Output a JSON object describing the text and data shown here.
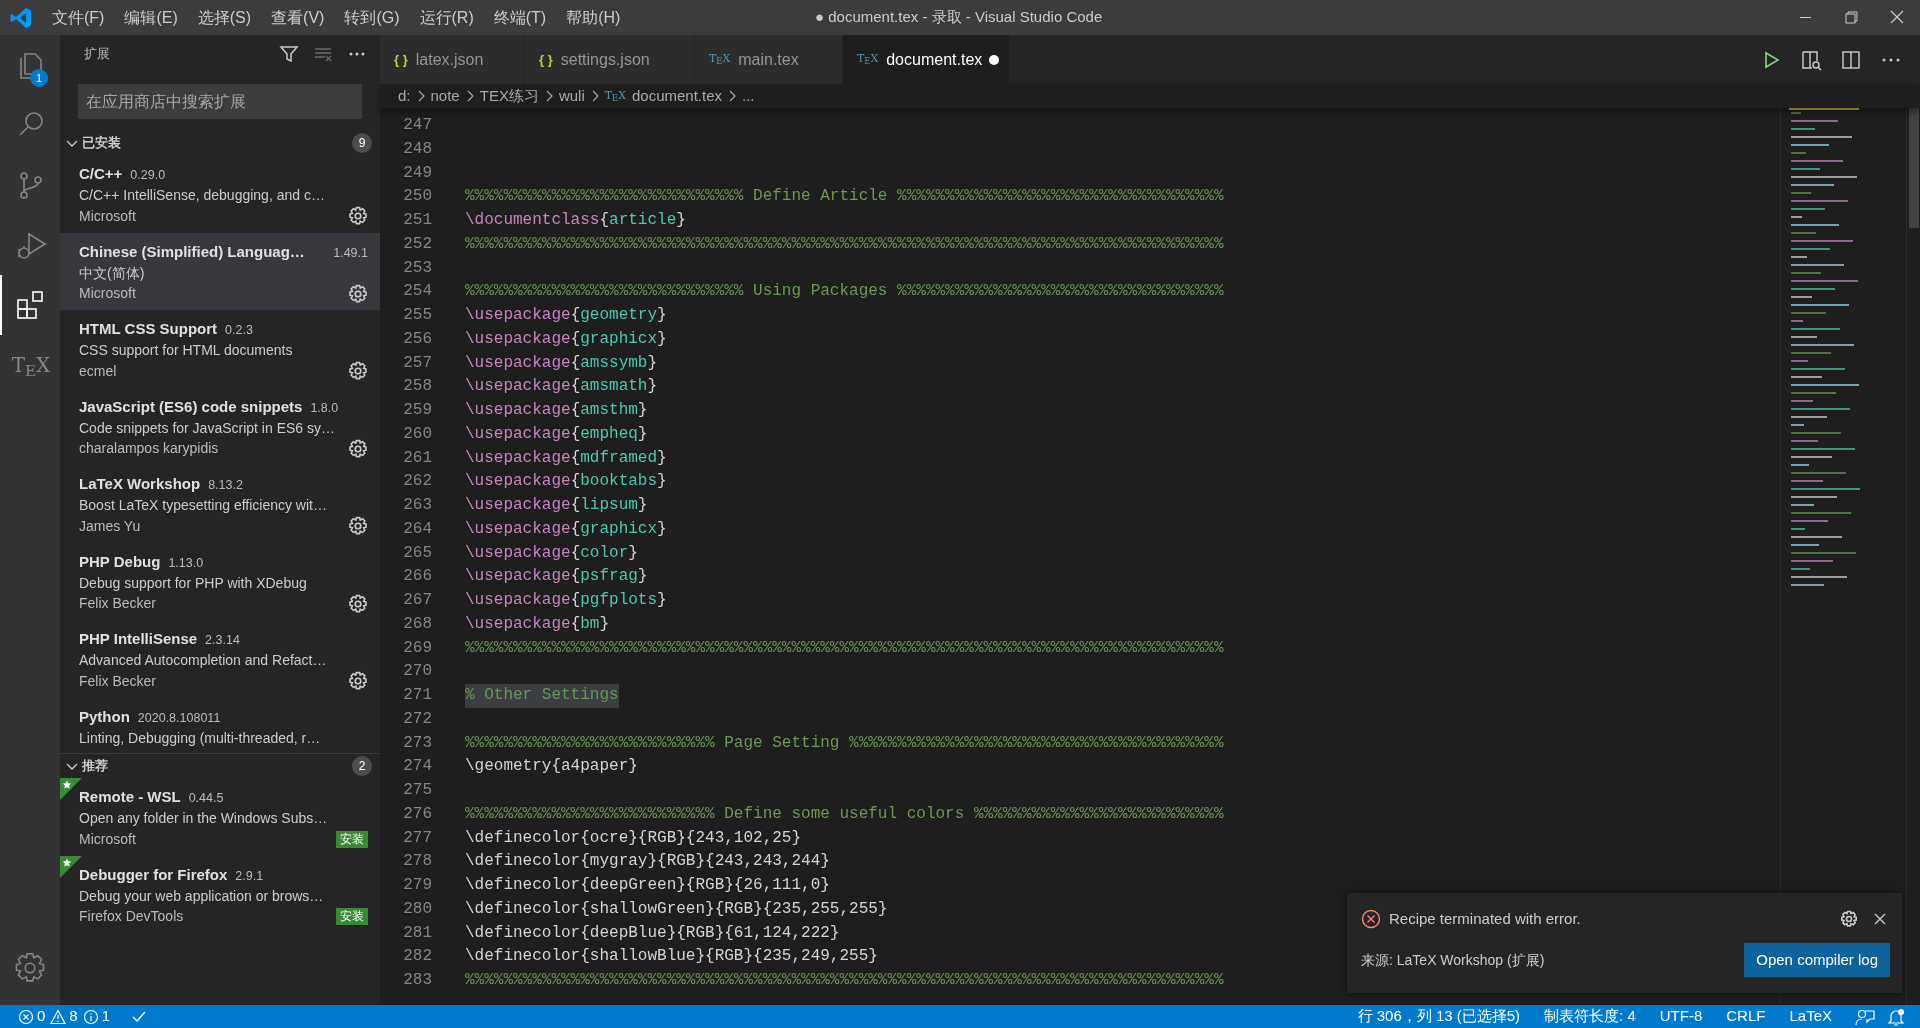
{
  "window": {
    "title": "● document.tex - 录取 - Visual Studio Code"
  },
  "menu": [
    "文件(F)",
    "编辑(E)",
    "选择(S)",
    "查看(V)",
    "转到(G)",
    "运行(R)",
    "终端(T)",
    "帮助(H)"
  ],
  "activity_bar": [
    {
      "kind": "explorer",
      "selected": false,
      "badge": "1"
    },
    {
      "kind": "search",
      "selected": false
    },
    {
      "kind": "source-control",
      "selected": false
    },
    {
      "kind": "run",
      "selected": false
    },
    {
      "kind": "extensions",
      "selected": true
    },
    {
      "kind": "tex",
      "selected": false,
      "label": "T$_{E}$X"
    }
  ],
  "sidebar": {
    "title": "扩展",
    "search": {
      "placeholder": "在应用商店中搜索扩展"
    },
    "sections": [
      {
        "title": "已安装",
        "expanded": true,
        "count": "9",
        "items": [
          {
            "kind": "installed",
            "name": "C/C++",
            "version": "0.29.0",
            "description": "C/C++ IntelliSense, debugging, and c…",
            "author": "Microsoft",
            "selected": false
          },
          {
            "kind": "installed",
            "name": "Chinese (Simplified) Languag…",
            "version": "1.49.1",
            "description": "中文(简体)",
            "author": "Microsoft",
            "selected": true
          },
          {
            "kind": "installed",
            "name": "HTML CSS Support",
            "version": "0.2.3",
            "description": "CSS support for HTML documents",
            "author": "ecmel",
            "selected": false
          },
          {
            "kind": "installed",
            "name": "JavaScript (ES6) code snippets",
            "version": "1.8.0",
            "description": "Code snippets for JavaScript in ES6 sy…",
            "author": "charalampos karypidis",
            "selected": false
          },
          {
            "kind": "installed",
            "name": "LaTeX Workshop",
            "version": "8.13.2",
            "description": "Boost LaTeX typesetting efficiency wit…",
            "author": "James Yu",
            "selected": false
          },
          {
            "kind": "installed",
            "name": "PHP Debug",
            "version": "1.13.0",
            "description": "Debug support for PHP with XDebug",
            "author": "Felix Becker",
            "selected": false
          },
          {
            "kind": "installed",
            "name": "PHP IntelliSense",
            "version": "2.3.14",
            "description": "Advanced Autocompletion and Refact…",
            "author": "Felix Becker",
            "selected": false
          },
          {
            "kind": "installed",
            "name": "Python",
            "version": "2020.8.108011",
            "description": "Linting, Debugging (multi-threaded, r…",
            "selected": false
          }
        ]
      },
      {
        "title": "推荐",
        "expanded": true,
        "count": "2",
        "items": [
          {
            "kind": "recommended",
            "name": "Remote - WSL",
            "version": "0.44.5",
            "description": "Open any folder in the Windows Subs…",
            "author": "Microsoft",
            "action": "安装",
            "selected": false
          },
          {
            "kind": "recommended",
            "name": "Debugger for Firefox",
            "version": "2.9.1",
            "description": "Debug your web application or brows…",
            "author": "Firefox DevTools",
            "action": "安装",
            "selected": false
          }
        ]
      }
    ]
  },
  "tabs": [
    {
      "kind": "json",
      "icon": "{ }",
      "label": "latex.json",
      "selected": false,
      "modified": false
    },
    {
      "kind": "json",
      "icon": "{ }",
      "label": "settings.json",
      "selected": false,
      "modified": false
    },
    {
      "kind": "tex",
      "icon": "T$_{E}$X",
      "label": "main.tex",
      "selected": false,
      "modified": false
    },
    {
      "kind": "tex",
      "icon": "T$_{E}$X",
      "label": "document.tex",
      "selected": true,
      "modified": true
    }
  ],
  "breadcrumbs": [
    {
      "label": "d:"
    },
    {
      "label": "note"
    },
    {
      "label": "TEX练习"
    },
    {
      "label": "wuli"
    },
    {
      "label": "document.tex",
      "icon": "T$_{E}$X"
    },
    {
      "label": "..."
    }
  ],
  "code_lines": [
    {
      "number": "247"
    },
    {
      "number": "248"
    },
    {
      "number": "249"
    },
    {
      "number": "250",
      "tokens": [
        {
          "kind": "comment",
          "text": "%%%%%%%%%%%%%%%%%%%%%%%%%%%%% Define Article %%%%%%%%%%%%%%%%%%%%%%%%%%%%%%%%%%"
        }
      ]
    },
    {
      "number": "251",
      "tokens": [
        {
          "kind": "command",
          "text": "\\documentclass"
        },
        {
          "kind": "brace",
          "text": "{"
        },
        {
          "kind": "arg",
          "text": "article"
        },
        {
          "kind": "brace",
          "text": "}"
        }
      ]
    },
    {
      "number": "252",
      "tokens": [
        {
          "kind": "comment",
          "text": "%%%%%%%%%%%%%%%%%%%%%%%%%%%%%%%%%%%%%%%%%%%%%%%%%%%%%%%%%%%%%%%%%%%%%%%%%%%%%%%"
        }
      ]
    },
    {
      "number": "253"
    },
    {
      "number": "254",
      "tokens": [
        {
          "kind": "comment",
          "text": "%%%%%%%%%%%%%%%%%%%%%%%%%%%%% Using Packages %%%%%%%%%%%%%%%%%%%%%%%%%%%%%%%%%%"
        }
      ]
    },
    {
      "number": "255",
      "tokens": [
        {
          "kind": "command",
          "text": "\\usepackage"
        },
        {
          "kind": "brace",
          "text": "{"
        },
        {
          "kind": "arg",
          "text": "geometry"
        },
        {
          "kind": "brace",
          "text": "}"
        }
      ]
    },
    {
      "number": "256",
      "tokens": [
        {
          "kind": "command",
          "text": "\\usepackage"
        },
        {
          "kind": "brace",
          "text": "{"
        },
        {
          "kind": "arg",
          "text": "graphicx"
        },
        {
          "kind": "brace",
          "text": "}"
        }
      ]
    },
    {
      "number": "257",
      "tokens": [
        {
          "kind": "command",
          "text": "\\usepackage"
        },
        {
          "kind": "brace",
          "text": "{"
        },
        {
          "kind": "arg",
          "text": "amssymb"
        },
        {
          "kind": "brace",
          "text": "}"
        }
      ]
    },
    {
      "number": "258",
      "tokens": [
        {
          "kind": "command",
          "text": "\\usepackage"
        },
        {
          "kind": "brace",
          "text": "{"
        },
        {
          "kind": "arg",
          "text": "amsmath"
        },
        {
          "kind": "brace",
          "text": "}"
        }
      ]
    },
    {
      "number": "259",
      "tokens": [
        {
          "kind": "command",
          "text": "\\usepackage"
        },
        {
          "kind": "brace",
          "text": "{"
        },
        {
          "kind": "arg",
          "text": "amsthm"
        },
        {
          "kind": "brace",
          "text": "}"
        }
      ]
    },
    {
      "number": "260",
      "tokens": [
        {
          "kind": "command",
          "text": "\\usepackage"
        },
        {
          "kind": "brace",
          "text": "{"
        },
        {
          "kind": "arg",
          "text": "empheq"
        },
        {
          "kind": "brace",
          "text": "}"
        }
      ]
    },
    {
      "number": "261",
      "tokens": [
        {
          "kind": "command",
          "text": "\\usepackage"
        },
        {
          "kind": "brace",
          "text": "{"
        },
        {
          "kind": "arg",
          "text": "mdframed"
        },
        {
          "kind": "brace",
          "text": "}"
        }
      ]
    },
    {
      "number": "262",
      "tokens": [
        {
          "kind": "command",
          "text": "\\usepackage"
        },
        {
          "kind": "brace",
          "text": "{"
        },
        {
          "kind": "arg",
          "text": "booktabs"
        },
        {
          "kind": "brace",
          "text": "}"
        }
      ]
    },
    {
      "number": "263",
      "tokens": [
        {
          "kind": "command",
          "text": "\\usepackage"
        },
        {
          "kind": "brace",
          "text": "{"
        },
        {
          "kind": "arg",
          "text": "lipsum"
        },
        {
          "kind": "brace",
          "text": "}"
        }
      ]
    },
    {
      "number": "264",
      "tokens": [
        {
          "kind": "command",
          "text": "\\usepackage"
        },
        {
          "kind": "brace",
          "text": "{"
        },
        {
          "kind": "arg",
          "text": "graphicx"
        },
        {
          "kind": "brace",
          "text": "}"
        }
      ]
    },
    {
      "number": "265",
      "tokens": [
        {
          "kind": "command",
          "text": "\\usepackage"
        },
        {
          "kind": "brace",
          "text": "{"
        },
        {
          "kind": "arg",
          "text": "color"
        },
        {
          "kind": "brace",
          "text": "}"
        }
      ]
    },
    {
      "number": "266",
      "tokens": [
        {
          "kind": "command",
          "text": "\\usepackage"
        },
        {
          "kind": "brace",
          "text": "{"
        },
        {
          "kind": "arg",
          "text": "psfrag"
        },
        {
          "kind": "brace",
          "text": "}"
        }
      ]
    },
    {
      "number": "267",
      "tokens": [
        {
          "kind": "command",
          "text": "\\usepackage"
        },
        {
          "kind": "brace",
          "text": "{"
        },
        {
          "kind": "arg",
          "text": "pgfplots"
        },
        {
          "kind": "brace",
          "text": "}"
        }
      ]
    },
    {
      "number": "268",
      "tokens": [
        {
          "kind": "command",
          "text": "\\usepackage"
        },
        {
          "kind": "brace",
          "text": "{"
        },
        {
          "kind": "arg",
          "text": "bm"
        },
        {
          "kind": "brace",
          "text": "}"
        }
      ]
    },
    {
      "number": "269",
      "tokens": [
        {
          "kind": "comment",
          "text": "%%%%%%%%%%%%%%%%%%%%%%%%%%%%%%%%%%%%%%%%%%%%%%%%%%%%%%%%%%%%%%%%%%%%%%%%%%%%%%%"
        }
      ]
    },
    {
      "number": "270"
    },
    {
      "number": "271",
      "tokens": [
        {
          "kind": "selection",
          "text": "% Other Settings"
        }
      ]
    },
    {
      "number": "272"
    },
    {
      "number": "273",
      "tokens": [
        {
          "kind": "comment",
          "text": "%%%%%%%%%%%%%%%%%%%%%%%%%% Page Setting %%%%%%%%%%%%%%%%%%%%%%%%%%%%%%%%%%%%%%%"
        }
      ]
    },
    {
      "number": "274",
      "tokens": [
        {
          "kind": "text",
          "text": "\\geometry{a4paper}"
        }
      ]
    },
    {
      "number": "275"
    },
    {
      "number": "276",
      "tokens": [
        {
          "kind": "comment",
          "text": "%%%%%%%%%%%%%%%%%%%%%%%%%% Define some useful colors %%%%%%%%%%%%%%%%%%%%%%%%%%"
        }
      ]
    },
    {
      "number": "277",
      "tokens": [
        {
          "kind": "text",
          "text": "\\definecolor{ocre}{RGB}{243,102,25}"
        }
      ]
    },
    {
      "number": "278",
      "tokens": [
        {
          "kind": "text",
          "text": "\\definecolor{mygray}{RGB}{243,243,244}"
        }
      ]
    },
    {
      "number": "279",
      "tokens": [
        {
          "kind": "text",
          "text": "\\definecolor{deepGreen}{RGB}{26,111,0}"
        }
      ]
    },
    {
      "number": "280",
      "tokens": [
        {
          "kind": "text",
          "text": "\\definecolor{shallowGreen}{RGB}{235,255,255}"
        }
      ]
    },
    {
      "number": "281",
      "tokens": [
        {
          "kind": "text",
          "text": "\\definecolor{deepBlue}{RGB}{61,124,222}"
        }
      ]
    },
    {
      "number": "282",
      "tokens": [
        {
          "kind": "text",
          "text": "\\definecolor{shallowBlue}{RGB}{235,249,255}"
        }
      ]
    },
    {
      "number": "283",
      "tokens": [
        {
          "kind": "comment",
          "text": "%%%%%%%%%%%%%%%%%%%%%%%%%%%%%%%%%%%%%%%%%%%%%%%%%%%%%%%%%%%%%%%%%%%%%%%%%%%%%%%"
        }
      ]
    }
  ],
  "notification": {
    "kind": "error",
    "message": "Recipe terminated with error.",
    "source": "来源: LaTeX Workshop (扩展)",
    "action": "Open compiler log"
  },
  "status_bar": {
    "errors": "0",
    "warnings": "8",
    "infos": "1",
    "right": [
      "行 306，列 13 (已选择5)",
      "制表符长度: 4",
      "UTF-8",
      "CRLF",
      "LaTeX"
    ],
    "notifications_unread": true
  }
}
